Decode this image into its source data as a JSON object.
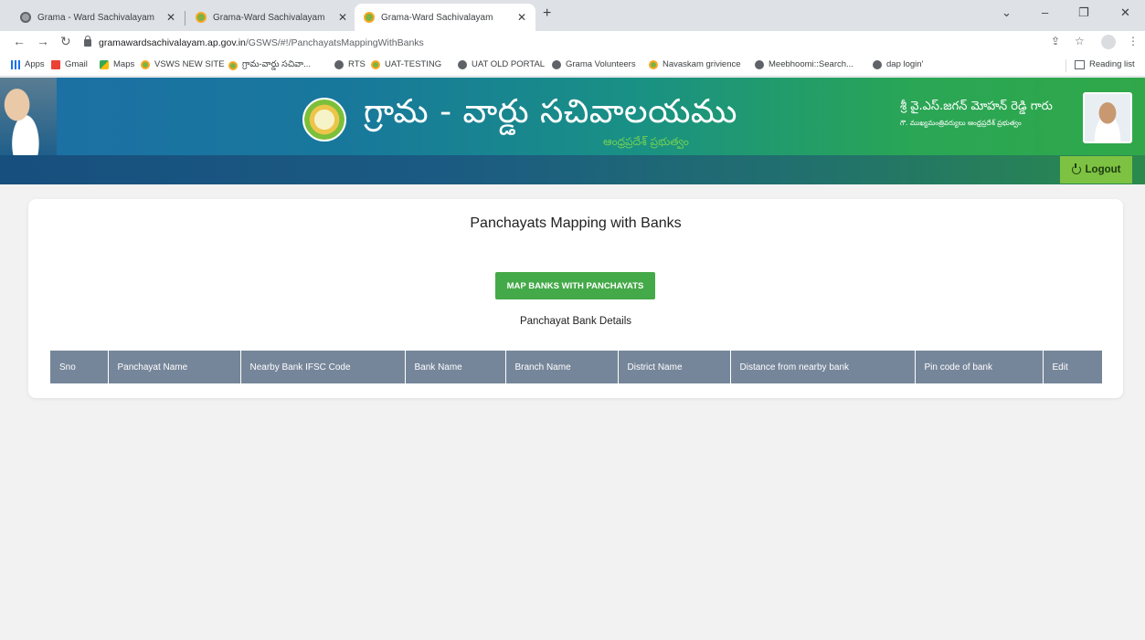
{
  "browser": {
    "tabs": [
      {
        "title": "Grama - Ward Sachivalayam",
        "active": false
      },
      {
        "title": "Grama-Ward Sachivalayam",
        "active": false
      },
      {
        "title": "Grama-Ward Sachivalayam",
        "active": true
      }
    ],
    "url_host": "gramawardsachivalayam.ap.gov.in",
    "url_path": "/GSWS/#!/PanchayatsMappingWithBanks",
    "bookmarks": [
      "Apps",
      "Gmail",
      "Maps",
      "VSWS NEW SITE",
      "గ్రామ-వార్డు సచివా...",
      "RTS",
      "UAT-TESTING",
      "UAT OLD PORTAL",
      "Grama Volunteers",
      "Navaskam grivience",
      "Meebhoomi::Search...",
      "dap login'"
    ],
    "reading_list": "Reading list"
  },
  "header": {
    "title": "గ్రామ - వార్డు సచివాలయము",
    "subtitle": "ఆంధ్రప్రదేశ్ ప్రభుత్వం",
    "cm_name": "శ్రీ వై.ఎస్.జగన్ మోహన్ రెడ్డి గారు",
    "cm_designation": "గౌ. ముఖ్యమంత్రివర్యులు ఆంధ్రప్రదేశ్ ప్రభుత్వం",
    "logout_label": "Logout"
  },
  "main": {
    "page_title": "Panchayats Mapping with Banks",
    "map_button_label": "MAP BANKS WITH PANCHAYATS",
    "table_title": "Panchayat Bank Details",
    "columns": [
      "Sno",
      "Panchayat Name",
      "Nearby Bank IFSC Code",
      "Bank Name",
      "Branch Name",
      "District Name",
      "Distance from nearby bank",
      "Pin code of bank",
      "Edit"
    ]
  }
}
